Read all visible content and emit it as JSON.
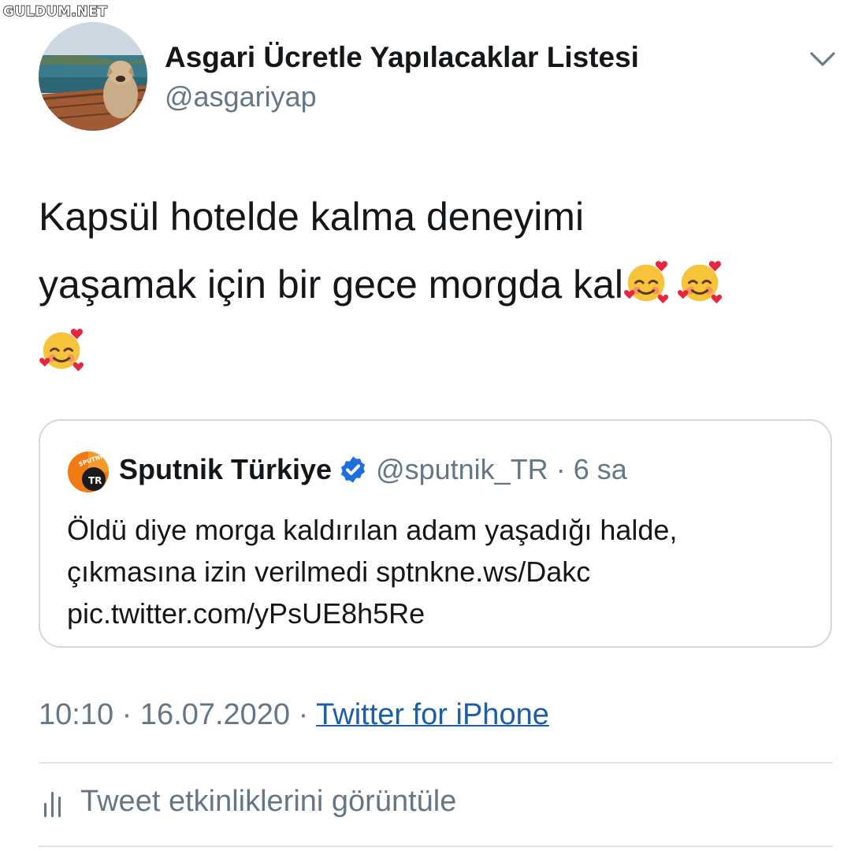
{
  "watermark": "GULDUM.NET",
  "tweet": {
    "display_name": "Asgari Ücretle Yapılacaklar Listesi",
    "handle": "@asgariyap",
    "text_line1": "Kapsül hotelde kalma deneyimi",
    "text_line2": "yaşamak için bir gece morgda kal",
    "emoji": "smiling-face-with-hearts",
    "emoji_count": 3
  },
  "quoted_tweet": {
    "avatar_text_top": "SPUTNIK",
    "avatar_text_bottom": "TR",
    "name": "Sputnik Türkiye",
    "verified": true,
    "handle": "@sputnik_TR",
    "separator": "·",
    "time": "6 sa",
    "text_line1": "Öldü diye morga kaldırılan adam yaşadığı halde,",
    "text_line2": "çıkmasına izin verilmedi sptnkne.ws/Dakc",
    "text_line3": "pic.twitter.com/yPsUE8h5Re"
  },
  "meta": {
    "time": "10:10",
    "separator": "·",
    "date": "16.07.2020",
    "source": "Twitter for iPhone"
  },
  "activity": {
    "label": "Tweet etkinliklerini görüntüle"
  },
  "colors": {
    "secondary_text": "#657786",
    "link": "#1b5fa8",
    "verified": "#1d6fe0",
    "card_border": "#cfd9de"
  }
}
